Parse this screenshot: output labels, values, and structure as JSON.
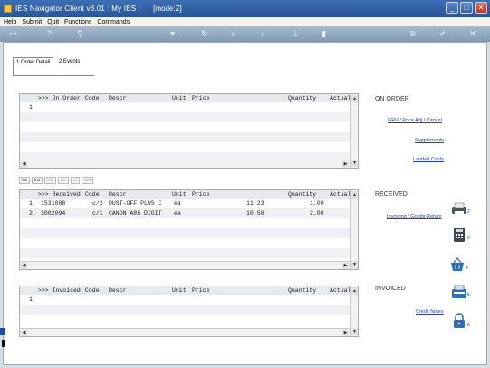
{
  "window": {
    "title": "IES Navigator Client v8.01 : My IES :",
    "mode": "[mode:Z]"
  },
  "menu": [
    "Help",
    "Submit",
    "Quit",
    "Functions",
    "Commands"
  ],
  "toolbar_icons": [
    "key-icon",
    "help-icon",
    "search-icon",
    "heart-icon",
    "refresh-icon",
    "rewind-icon",
    "fast-forward-icon",
    "pin-icon",
    "exit-icon",
    "lock-icon",
    "check-icon",
    "close-icon"
  ],
  "tabs": [
    {
      "label": "1 Order Detail"
    },
    {
      "label": "2 Events"
    }
  ],
  "columns": {
    "on_order": ">>> On Order",
    "received": ">>> Received",
    "invoiced": ">>> Invoiced",
    "code": "Code",
    "descr": "Descr",
    "unit": "Unit",
    "price": "Price",
    "quantity": "Quantity",
    "actual": "Actual"
  },
  "on_order": {
    "rows": [
      {
        "n": "1"
      }
    ]
  },
  "received": {
    "rows": [
      {
        "n": "1",
        "num": "1531088",
        "code": "c/2",
        "descr": "DUST-OFF PLUS C",
        "unit": "ea",
        "price": "11.23",
        "qty": "1.00"
      },
      {
        "n": "2",
        "num": "3002094",
        "code": "c/1",
        "descr": "CANON A85 DIGIT",
        "unit": "ea",
        "price": "10.50",
        "qty": "2.00"
      }
    ]
  },
  "invoiced": {
    "rows": [
      {
        "n": "1"
      }
    ]
  },
  "nav_buttons": [
    "Ins",
    "Ins",
    "Edt",
    "Inc",
    "Cl",
    "Del"
  ],
  "side": {
    "on_order_title": "ON ORDER",
    "grv_link": "GRV / Price Adj / Cancel",
    "supplements_link": "Supplements",
    "landed_link": "Landed Costs",
    "received_title": "RECEIVED",
    "invoicing_link": "Invoicing / Goods Return",
    "invoiced_title": "INVOICED",
    "credit_link": "Credit Notes",
    "icon_nums": [
      "2",
      "3",
      "4",
      "5",
      "6"
    ]
  }
}
